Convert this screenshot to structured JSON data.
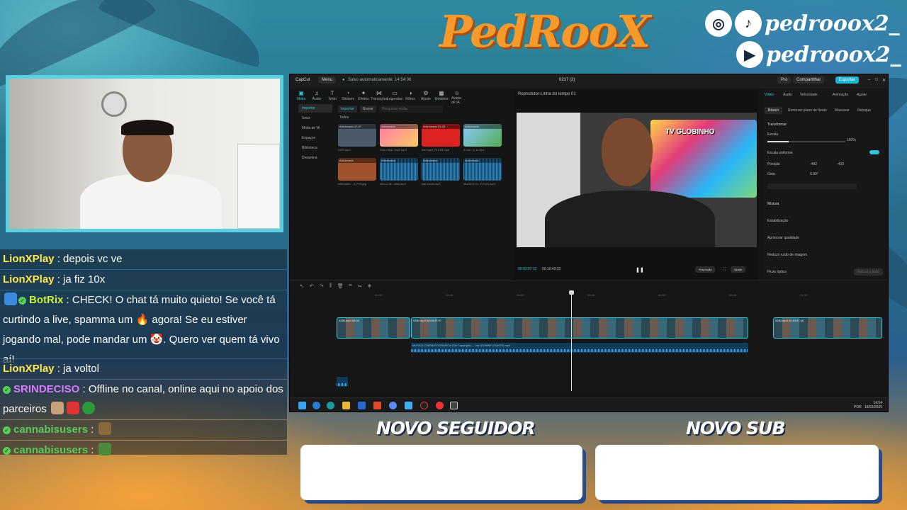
{
  "overlay": {
    "logo_text": "PedRooX",
    "handle_instagram_tiktok": "pedrooox2_",
    "handle_youtube": "pedrooox2_",
    "follower_title": "NOVO SEGUIDOR",
    "sub_title": "NOVO SUB"
  },
  "chat": [
    {
      "user": "LionXPlay",
      "sep": " : ",
      "text": "depois vc ve",
      "color": "#ffe94d"
    },
    {
      "user": "LionXPlay",
      "sep": " : ",
      "text": "ja fiz 10x",
      "color": "#ffe94d"
    },
    {
      "user": "BotRix",
      "sep": " : ",
      "text": "CHECK! O chat tá muito quieto! Se você tá curtindo a live, spamma um 🔥 agora! Se eu estiver jogando mal, pode mandar um 🤡. Quero ver quem tá vivo aí!",
      "color": "#c8f23a"
    },
    {
      "user": "LionXPlay",
      "sep": " : ",
      "text": "ja voltol",
      "color": "#ffe94d"
    },
    {
      "user": "SRINDECISO",
      "sep": " : ",
      "text": "Offline no canal, online aqui no apoio dos parceiros",
      "color": "#d67bff"
    },
    {
      "user": "cannabisusers",
      "sep": " : ",
      "text": "",
      "color": "#5ac85a"
    },
    {
      "user": "cannabisusers",
      "sep": " : ",
      "text": "",
      "color": "#5ac85a"
    }
  ],
  "editor": {
    "app_name": "CapCut",
    "menu": "Menu",
    "autosave": "Salvo automaticamente: 14:54:06",
    "project": "0217 (2)",
    "pro": "Pro",
    "share": "Compartilhar",
    "export": "Exportar",
    "toolbar": [
      "Mídia",
      "Áudio",
      "Texto",
      "Stickers",
      "Efeitos",
      "Transições",
      "Legendas",
      "Filtros",
      "Ajuste",
      "Modelos",
      "Avatar de IA"
    ],
    "sidebar": [
      "Importar",
      "Seus",
      "Mídia de IA",
      "Espaços",
      "Biblioteca",
      "Dreamina"
    ],
    "media_bar": {
      "import": "Importar",
      "record": "Gravar",
      "search_placeholder": "Pesquisar mídia"
    },
    "all_label": "Todos",
    "added": "Adicionado",
    "thumbs": [
      {
        "name": "0280.mp4",
        "time": "17:37"
      },
      {
        "name": "Goku Sup...mp4 mp4",
        "time": ""
      },
      {
        "name": "Nin-bqsh_PLK93.mp4",
        "time": "21:43"
      },
      {
        "name": "A noo...k_D.mp4",
        "time": ""
      },
      {
        "name": "hélimarlen...d_P29.jpg",
        "time": ""
      },
      {
        "name": "olha-o-de...dato.mp3",
        "time": ""
      },
      {
        "name": "olar-koula.mp3",
        "time": ""
      },
      {
        "name": "MUSICA CI...FJY(0).mp3",
        "time": ""
      }
    ],
    "player_title": "Reprodutor-Linha do tempo 01",
    "video_overlay_text": "TV GLOBINHO",
    "current_time": "00:03:07:12",
    "total_time": "00:16:43:22",
    "player_btn_full": "Proporção",
    "player_btn_ratio": "Ajuste",
    "inspector_tabs": [
      "Vídeo",
      "Áudio",
      "Velocidade",
      "Animação",
      "Ajuste"
    ],
    "inspector_subtabs": [
      "Básico",
      "Remover plano de fundo",
      "Mascarar",
      "Retoque"
    ],
    "transform": "Transformar",
    "scale_label": "Escala",
    "scale_value": "160%",
    "uniform_scale": "Escala uniforme",
    "position_label": "Posição",
    "pos_x": "-492",
    "pos_y": "-423",
    "rotate_label": "Girar",
    "rotate_value": "0.00°",
    "blend": "Mistura",
    "stabilize": "Estabilização",
    "enhance": "Aprimorar qualidade",
    "denoise": "Reduzir ruído de imagem",
    "optical": "Fluxo óptico",
    "apply_all": "Aplicar a tudo",
    "ruler": [
      "00:00",
      "10:00",
      "20:00",
      "30:00",
      "40:00",
      "50:00",
      "01:00"
    ],
    "clip_a": "0280.mp4 00:00",
    "clip_b": "0280.mp4  00:00:47:07",
    "clip_c": "0280.mp4  00:10:37:26",
    "audio_clip": "MUSICA CINEMATOGRAFICA (Sin Copyright) - ...ws (DOWNFLOUNTS).mp3",
    "taskbar_time": "14:54",
    "taskbar_date": "18/02/2026",
    "taskbar_lang": "POR"
  }
}
